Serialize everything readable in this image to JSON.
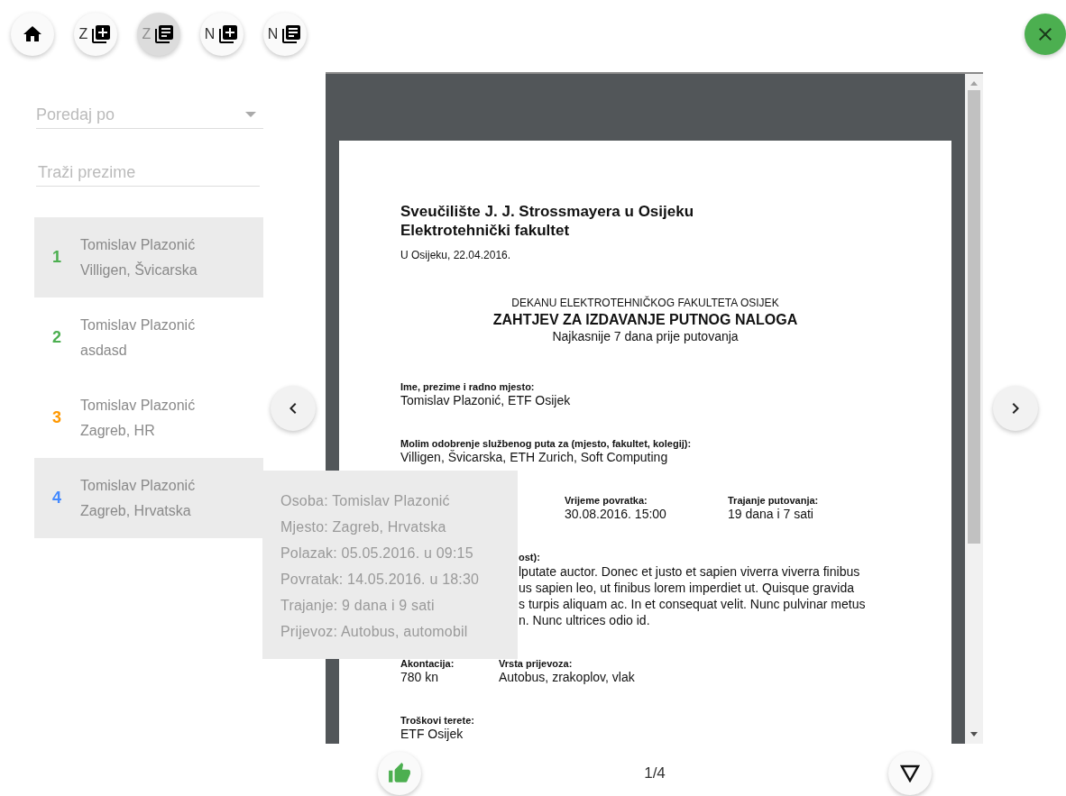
{
  "toolbar": {
    "buttons": [
      {
        "kind": "home",
        "selected": false
      },
      {
        "kind": "add",
        "letter": "Z",
        "selected": false
      },
      {
        "kind": "list",
        "letter": "Z",
        "selected": true
      },
      {
        "kind": "add",
        "letter": "N",
        "selected": false
      },
      {
        "kind": "list",
        "letter": "N",
        "selected": false
      }
    ],
    "close": {
      "kind": "close"
    }
  },
  "sort_select": {
    "placeholder": "Poredaj po"
  },
  "search": {
    "placeholder": "Traži prezime"
  },
  "trips": [
    {
      "number": "1",
      "name": "Tomislav Plazonić",
      "place": "Villigen, Švicarska",
      "color": "#4caf50",
      "selected": true
    },
    {
      "number": "2",
      "name": "Tomislav Plazonić",
      "place": "asdasd",
      "color": "#4caf50",
      "selected": false
    },
    {
      "number": "3",
      "name": "Tomislav Plazonić",
      "place": "Zagreb, HR",
      "color": "#ff9800",
      "selected": false
    },
    {
      "number": "4",
      "name": "Tomislav Plazonić",
      "place": "Zagreb, Hrvatska",
      "color": "#448aff",
      "selected": true
    }
  ],
  "tooltip": {
    "lines": [
      "Osoba: Tomislav Plazonić",
      "Mjesto: Zagreb, Hrvatska",
      "Polazak: 05.05.2016. u 09:15",
      "Povratak: 14.05.2016. u 18:30",
      "Trajanje: 9 dana i 9 sati",
      "Prijevoz: Autobus, automobil"
    ]
  },
  "document": {
    "header_lines": [
      "Sveučilište J. J. Strossmayera u Osijeku",
      "Elektrotehnički fakultet"
    ],
    "date": "U Osijeku, 22.04.2016.",
    "addressee": "DEKANU ELEKTROTEHNIČKOG FAKULTETA OSIJEK",
    "title": "ZAHTJEV ZA IZDAVANJE PUTNOG NALOGA",
    "subtitle": "Najkasnije 7 dana prije putovanja",
    "sections": [
      {
        "kind": "field",
        "label": "Ime, prezime i radno mjesto:",
        "value": "Tomislav Plazonić, ETF Osijek"
      },
      {
        "kind": "field",
        "label": "Molim odobrenje službenog puta za (mjesto, fakultet, kolegij):",
        "value": "Villigen, Švicarska, ETH Zurich, Soft Computing"
      },
      {
        "kind": "covered_row",
        "items": [
          {
            "label": "Vrijeme povratka:",
            "value": "30.08.2016. 15:00"
          },
          {
            "label": "Trajanje putovanja:",
            "value": "19 dana i 7 sati"
          }
        ]
      },
      {
        "kind": "covered_text",
        "label": "ost):",
        "lines": [
          "lputate auctor. Donec et justo et sapien viverra viverra finibus",
          "us sapien leo, ut finibus lorem imperdiet ut. Quisque gravida",
          "s turpis aliquam ac. In et consequat velit. Nunc pulvinar metus",
          "n. Nunc ultrices odio id."
        ]
      },
      {
        "kind": "row",
        "items": [
          {
            "label": "Akontacija:",
            "value": "780 kn"
          },
          {
            "label": "Vrsta prijevoza:",
            "value": "Autobus, zrakoplov, vlak"
          }
        ]
      },
      {
        "kind": "field",
        "label": "Troškovi terete:",
        "value": "ETF Osijek"
      }
    ]
  },
  "pager": {
    "page": "1/4"
  }
}
